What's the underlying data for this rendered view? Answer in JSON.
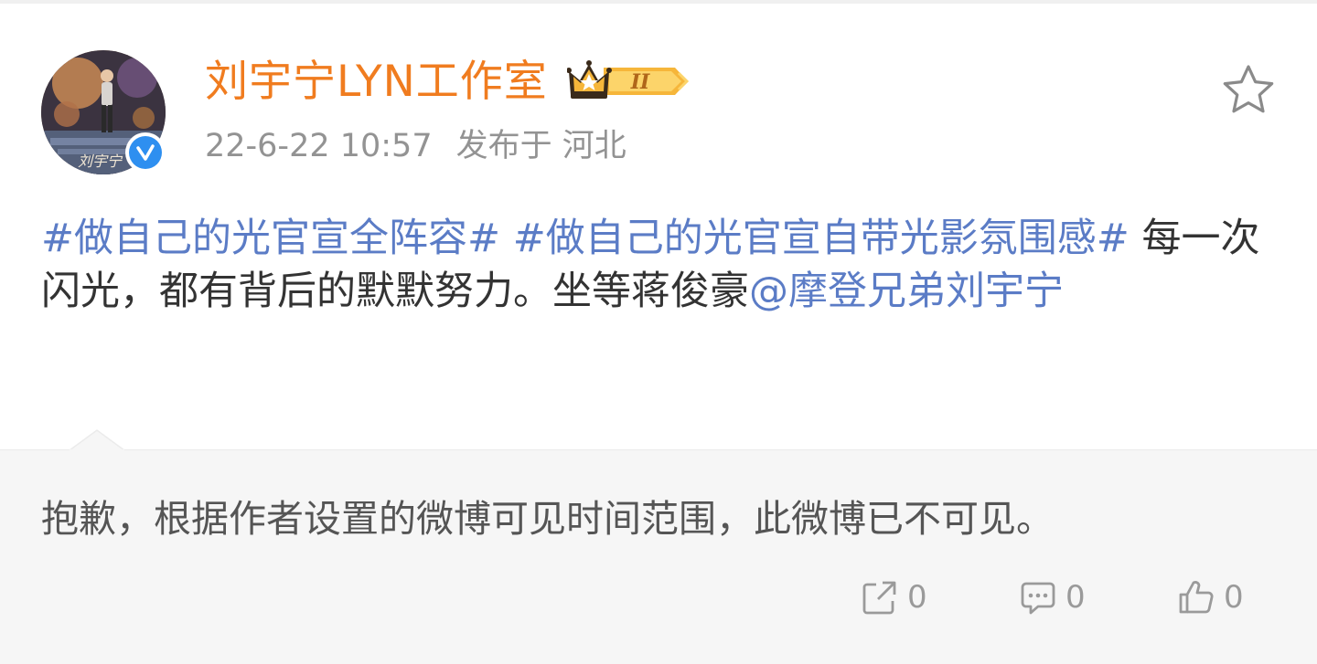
{
  "post": {
    "author": "刘宇宁LYN工作室",
    "vip_badge": "II",
    "timestamp": "22-6-22 10:57",
    "location_label": "发布于 河北",
    "avatar_caption": "刘宇宁",
    "content": {
      "tag1": "#做自己的光官宣全阵容#",
      "tag2": "#做自己的光官宣自带光影氛围感#",
      "text": " 每一次闪光，都有背后的默默努力。坐等蒋俊豪",
      "mention": "@摩登兄弟刘宇宁"
    },
    "notice": "抱歉，根据作者设置的微博可见时间范围，此微博已不可见。"
  },
  "actions": {
    "repost_count": "0",
    "comment_count": "0",
    "like_count": "0"
  },
  "icons": {
    "favorite": "star-outline-icon",
    "repost": "repost-icon",
    "comment": "comment-icon",
    "like": "thumbs-up-icon",
    "verified": "verified-check-icon",
    "vip": "crown-vip-icon"
  },
  "colors": {
    "author": "#f07c1f",
    "link": "#5b7cc6",
    "meta": "#939393",
    "verified": "#2e8ff0"
  }
}
